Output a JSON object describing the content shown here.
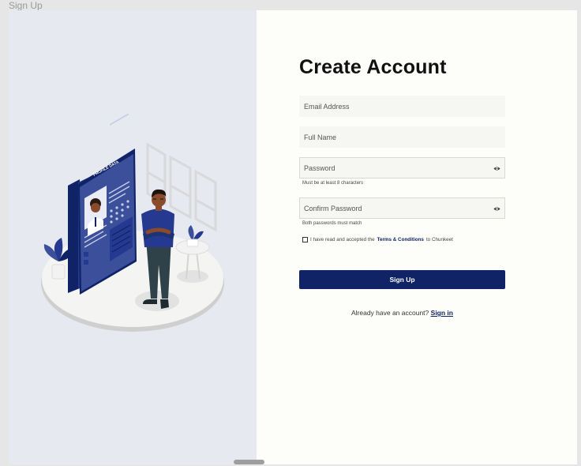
{
  "window": {
    "title": "Sign Up"
  },
  "form": {
    "heading": "Create Account",
    "email": {
      "placeholder": "Email Address",
      "value": ""
    },
    "full_name": {
      "placeholder": "Full Name",
      "value": ""
    },
    "password": {
      "placeholder": "Password",
      "value": "",
      "hint": "Must be at least 8 characters",
      "icon": "eye-icon"
    },
    "confirm_password": {
      "placeholder": "Confirm Password",
      "value": "",
      "hint": "Both passwords must match",
      "icon": "eye-icon"
    },
    "terms": {
      "prefix": "I have read and accepted the",
      "link": "Terms & Conditions",
      "suffix": "to Chunkeet",
      "checked": false
    },
    "submit_label": "Sign Up",
    "signin_prompt": "Already have an account?",
    "signin_link": "Sign in"
  },
  "illustration": {
    "card_title": "PROFILE DATA"
  },
  "colors": {
    "brand": "#0f2366",
    "left_panel": "#e6e9f0",
    "right_panel": "#fdfdf9"
  }
}
